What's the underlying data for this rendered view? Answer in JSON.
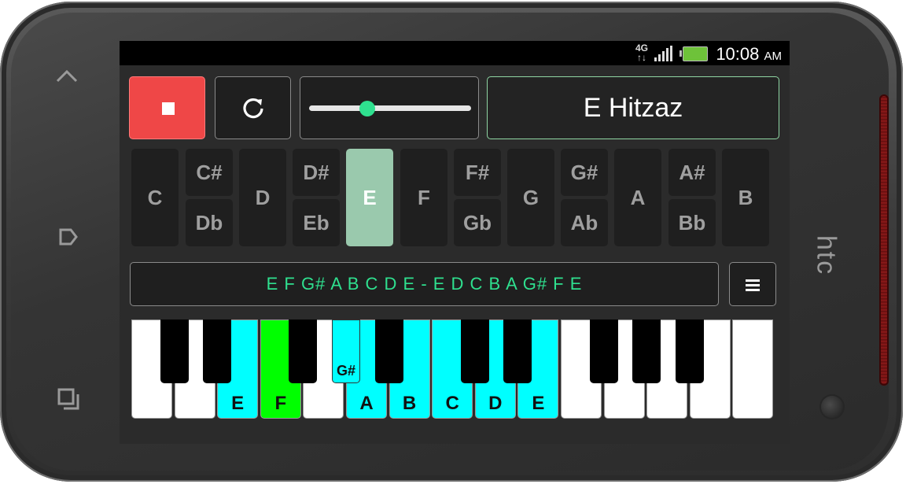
{
  "status_bar": {
    "network": "4G",
    "time": "10:08",
    "ampm": "AM"
  },
  "phone": {
    "brand": "htc",
    "nav_icons": [
      "chevron-up-icon",
      "back-icon",
      "recents-icon"
    ]
  },
  "controls": {
    "stop_icon": "stop-icon",
    "reset_icon": "replay-icon",
    "tempo_slider_value": 0.36,
    "scale_name": "E Hitzaz"
  },
  "key_selector": {
    "selected": "E",
    "keys": [
      {
        "type": "natural",
        "label": "C"
      },
      {
        "type": "accidental",
        "sharp": "C#",
        "flat": "Db"
      },
      {
        "type": "natural",
        "label": "D"
      },
      {
        "type": "accidental",
        "sharp": "D#",
        "flat": "Eb"
      },
      {
        "type": "natural",
        "label": "E"
      },
      {
        "type": "natural",
        "label": "F"
      },
      {
        "type": "accidental",
        "sharp": "F#",
        "flat": "Gb"
      },
      {
        "type": "natural",
        "label": "G"
      },
      {
        "type": "accidental",
        "sharp": "G#",
        "flat": "Ab"
      },
      {
        "type": "natural",
        "label": "A"
      },
      {
        "type": "accidental",
        "sharp": "A#",
        "flat": "Bb"
      },
      {
        "type": "natural",
        "label": "B"
      }
    ]
  },
  "scale_notes": "E F G# A B C D E - E D C B A G# F E",
  "piano": {
    "colors": {
      "scale": "#00ffff",
      "active": "#00ff00",
      "white": "#ffffff",
      "black": "#000000"
    },
    "white_keys": [
      {
        "label": "",
        "state": "none"
      },
      {
        "label": "",
        "state": "none"
      },
      {
        "label": "E",
        "state": "scale"
      },
      {
        "label": "F",
        "state": "active"
      },
      {
        "label": "",
        "state": "none"
      },
      {
        "label": "A",
        "state": "scale"
      },
      {
        "label": "B",
        "state": "scale"
      },
      {
        "label": "C",
        "state": "scale"
      },
      {
        "label": "D",
        "state": "scale"
      },
      {
        "label": "E",
        "state": "scale"
      },
      {
        "label": "",
        "state": "none"
      },
      {
        "label": "",
        "state": "none"
      },
      {
        "label": "",
        "state": "none"
      },
      {
        "label": "",
        "state": "none"
      },
      {
        "label": "",
        "state": "none"
      }
    ],
    "black_keys": [
      {
        "label": "",
        "state": "none"
      },
      {
        "label": "",
        "state": "none"
      },
      {
        "label": "",
        "state": "none"
      },
      {
        "label": "G#",
        "state": "scale"
      },
      {
        "label": "",
        "state": "none"
      },
      {
        "label": "",
        "state": "none"
      },
      {
        "label": "",
        "state": "none"
      },
      {
        "label": "",
        "state": "none"
      },
      {
        "label": "",
        "state": "none"
      },
      {
        "label": "",
        "state": "none"
      }
    ]
  }
}
